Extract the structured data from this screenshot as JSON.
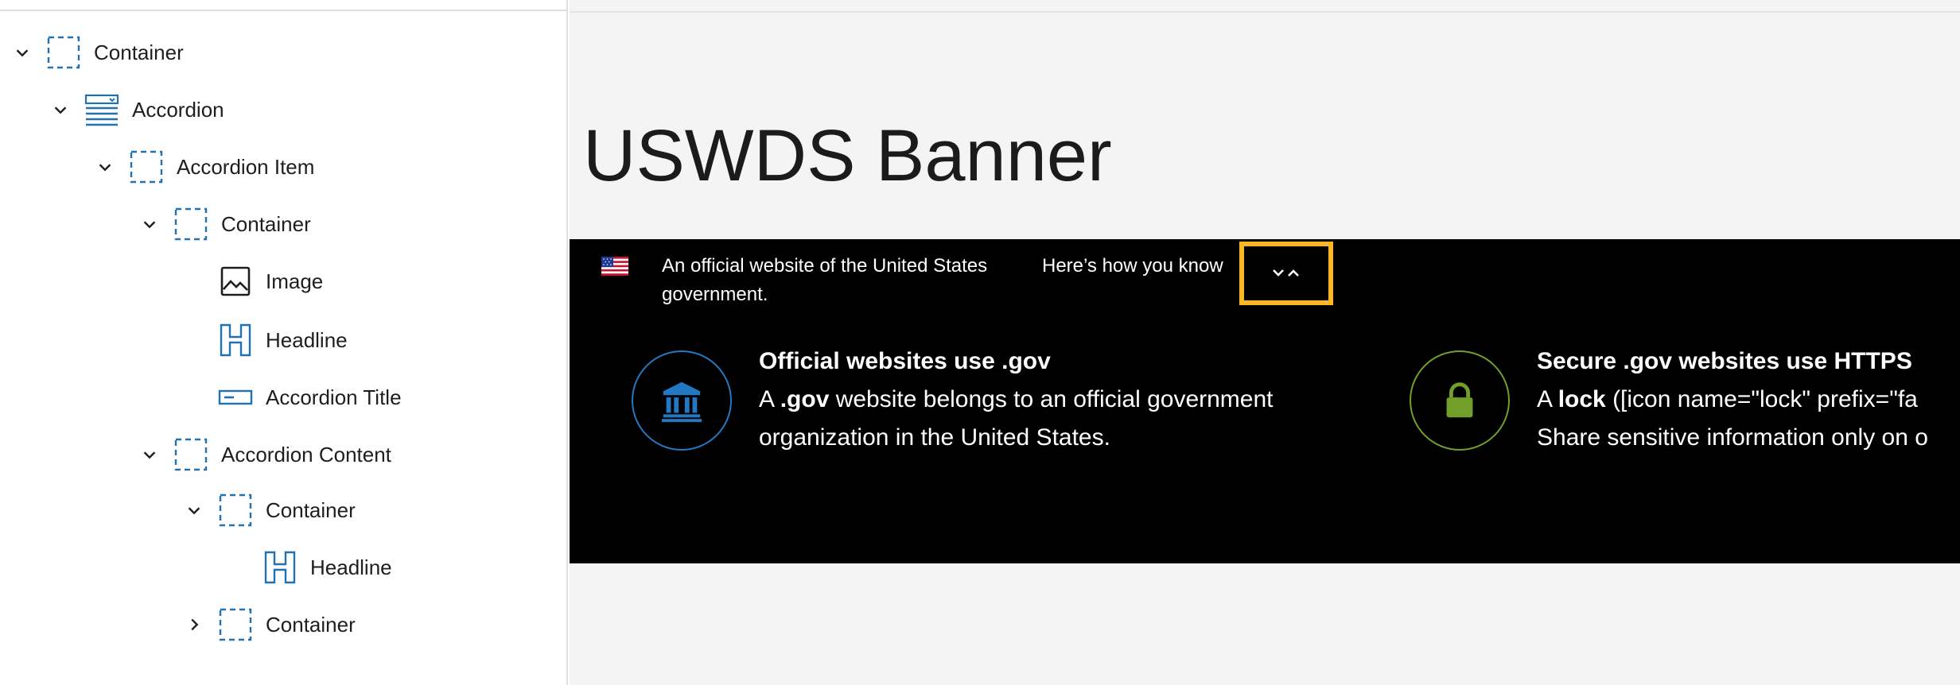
{
  "list_view": {
    "items": [
      {
        "label": "Container",
        "icon": "container-icon",
        "expanded": "true"
      },
      {
        "label": "Accordion",
        "icon": "accordion-icon",
        "expanded": "true"
      },
      {
        "label": "Accordion Item",
        "icon": "container-icon",
        "expanded": "true"
      },
      {
        "label": "Container",
        "icon": "container-icon",
        "expanded": "true"
      },
      {
        "label": "Image",
        "icon": "image-icon"
      },
      {
        "label": "Headline",
        "icon": "headline-icon"
      },
      {
        "label": "Accordion Title",
        "icon": "accordion-title-icon"
      },
      {
        "label": "Accordion Content",
        "icon": "container-icon",
        "expanded": "true"
      },
      {
        "label": "Container",
        "icon": "container-icon",
        "expanded": "true"
      },
      {
        "label": "Headline",
        "icon": "headline-icon"
      },
      {
        "label": "Container",
        "icon": "container-icon",
        "expanded": "false"
      }
    ]
  },
  "canvas": {
    "page_title": "USWDS Banner",
    "banner": {
      "official_text": "An official website of the United States government.",
      "how_know": "Here’s how you know",
      "toggle_icon": "chevron-down-up-icon",
      "guidance": [
        {
          "icon": "bank-icon",
          "heading": "Official websites use .gov",
          "body_pre": "A ",
          "body_bold": ".gov",
          "body_post": " website belongs to an official government",
          "body_line2": "organization in the United States."
        },
        {
          "icon": "lock-icon",
          "heading": "Secure .gov websites use HTTPS",
          "body_pre": "A ",
          "body_bold": "lock",
          "body_post": " ([icon name=\"lock\" prefix=\"fa",
          "body_line2": "Share sensitive information only on o"
        }
      ]
    }
  },
  "colors": {
    "block_icon_blue": "#2271b1",
    "toggle_outline": "#fbb824",
    "gov_icon": "#2378c3",
    "lock_icon": "#719f2a",
    "banner_bg": "#000000",
    "canvas_bg": "#f4f4f4"
  }
}
